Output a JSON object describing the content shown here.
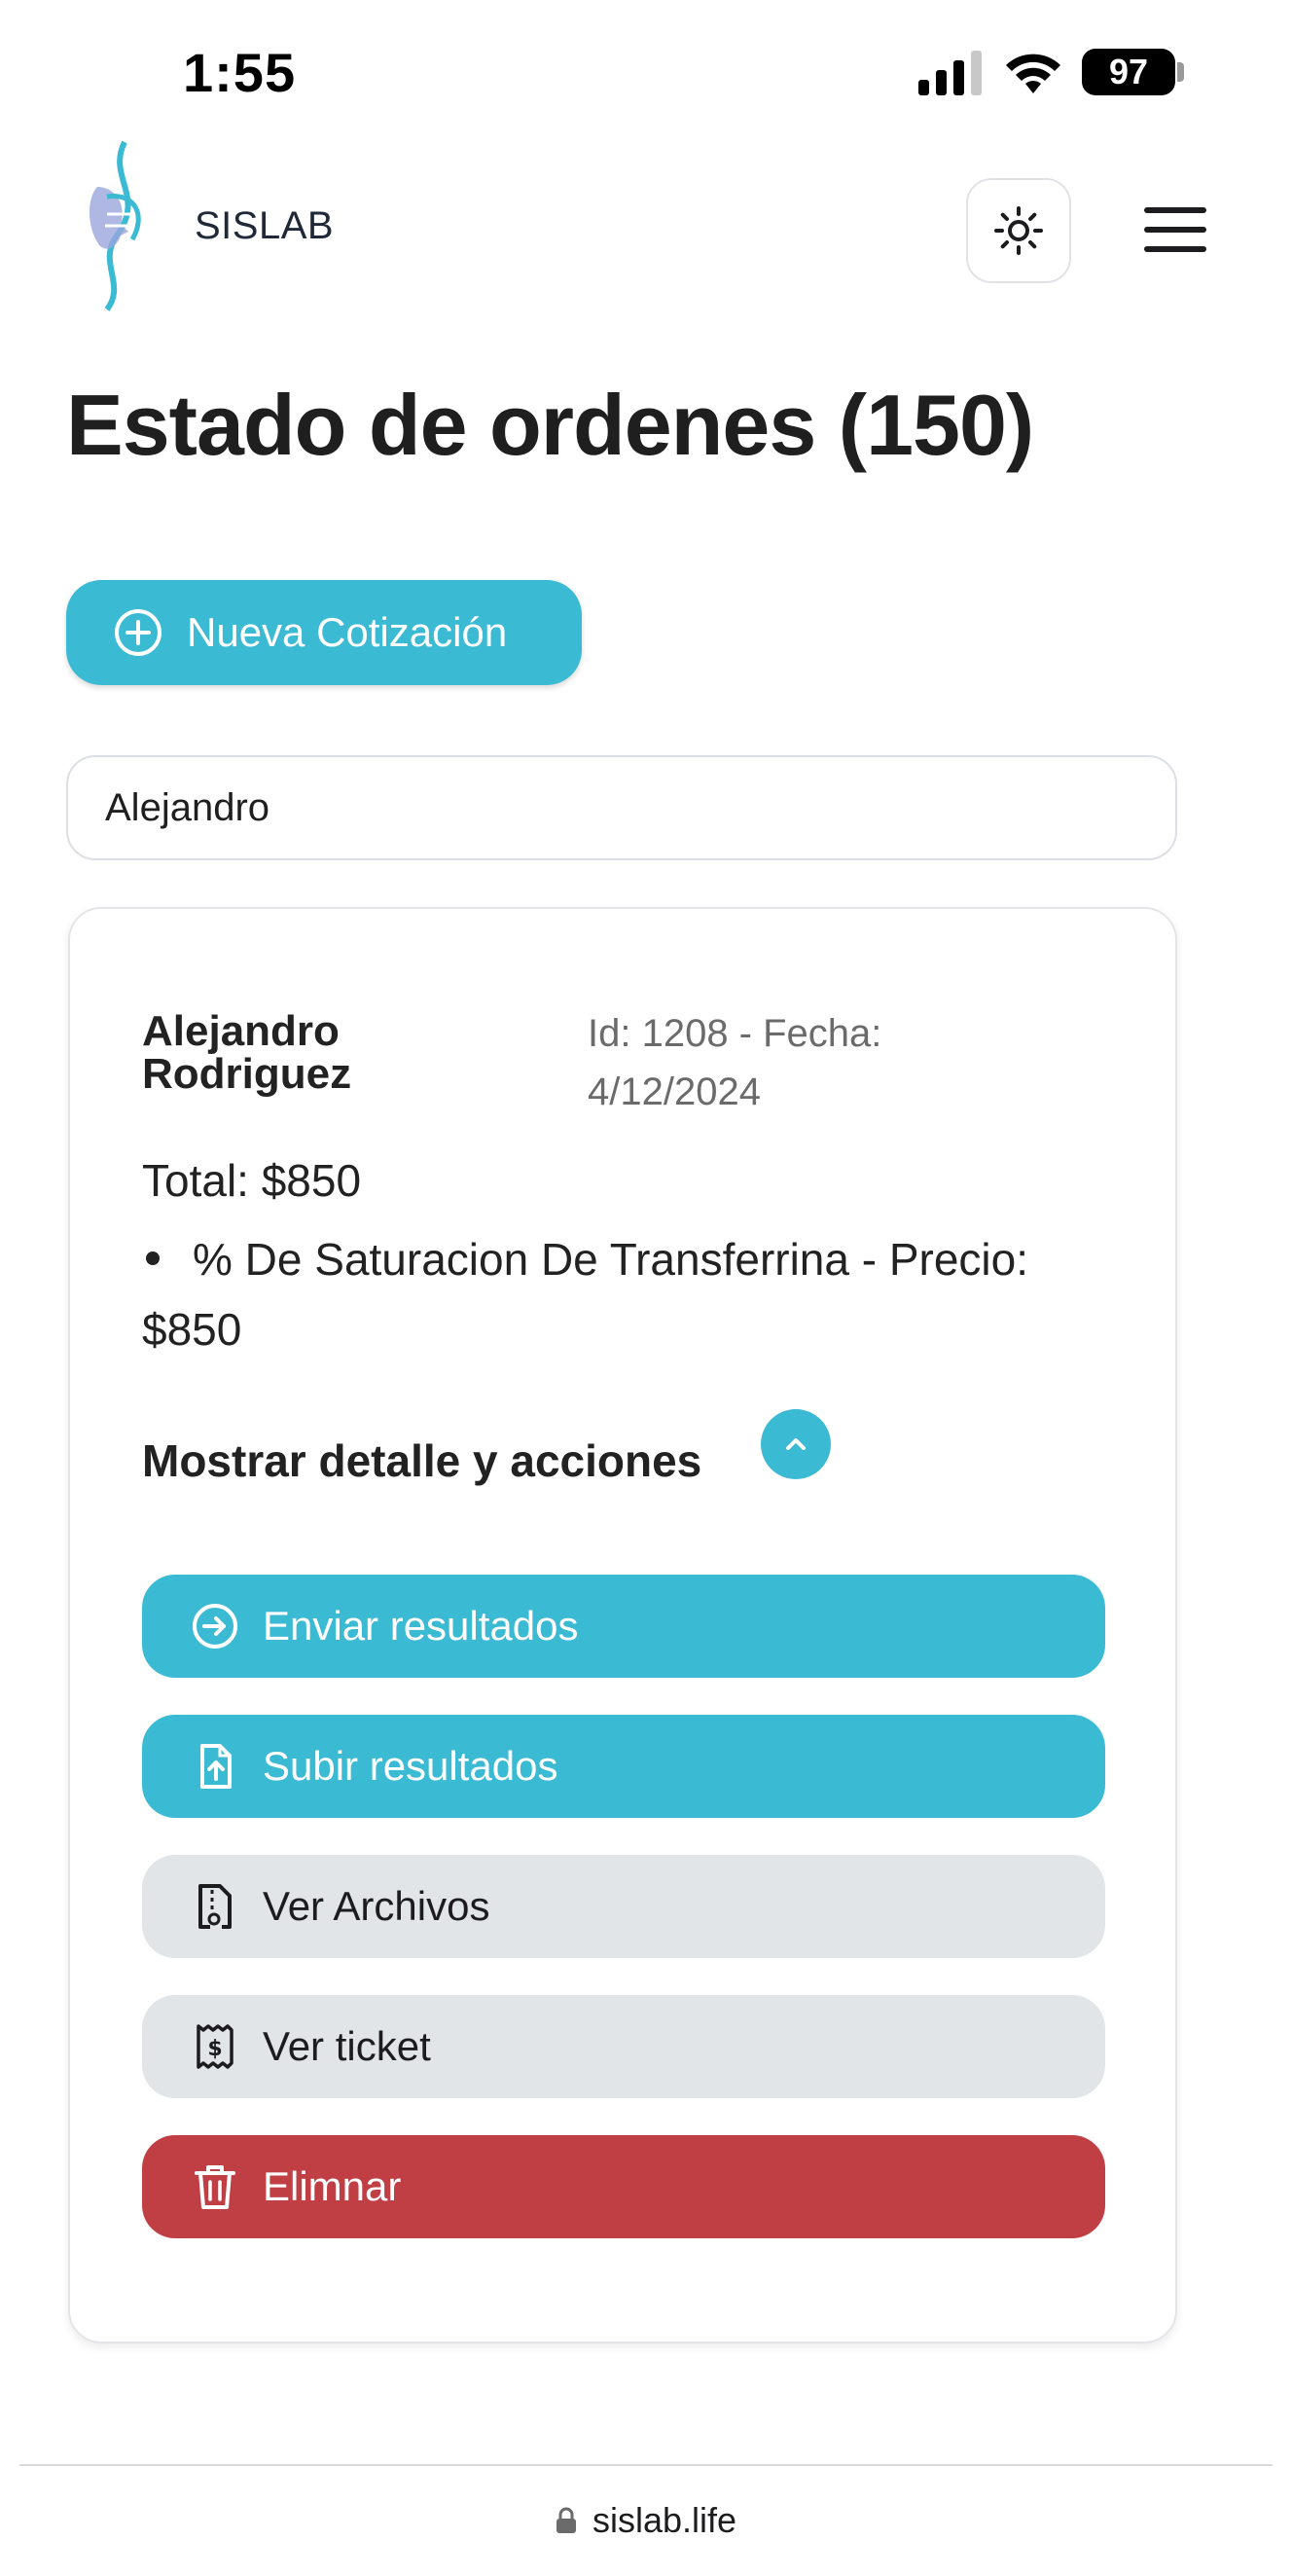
{
  "status_bar": {
    "time": "1:55",
    "battery": "97"
  },
  "header": {
    "brand": "SISLAB"
  },
  "page": {
    "title": "Estado de ordenes (150)"
  },
  "actions": {
    "new_quote": "Nueva Cotización"
  },
  "search": {
    "value": "Alejandro"
  },
  "order": {
    "patient_name": "Alejandro Rodriguez",
    "meta": "Id: 1208 - Fecha: 4/12/2024",
    "total": "Total: $850",
    "items": [
      "% De Saturacion De Transferrina - Precio: $850"
    ],
    "details_label": "Mostrar detalle y acciones",
    "buttons": {
      "send_results": "Enviar resultados",
      "upload_results": "Subir resultados",
      "view_files": "Ver Archivos",
      "view_ticket": "Ver ticket",
      "delete": "Elimnar"
    }
  },
  "browser": {
    "url": "sislab.life"
  },
  "colors": {
    "accent": "#3bbad4",
    "danger": "#c03f44",
    "secondary": "#e2e5e7"
  }
}
